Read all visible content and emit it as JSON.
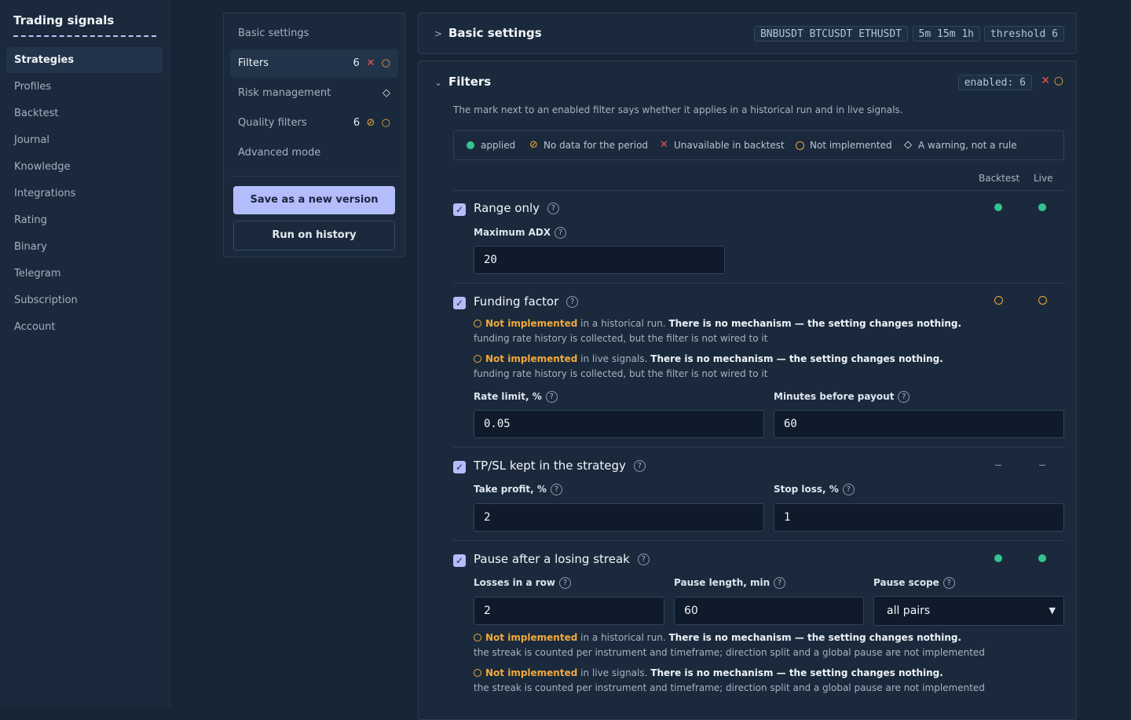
{
  "app": {
    "title": "Trading signals"
  },
  "nav": [
    "Strategies",
    "Profiles",
    "Backtest",
    "Journal",
    "Knowledge",
    "Integrations",
    "Rating",
    "Binary",
    "Telegram",
    "Subscription",
    "Account"
  ],
  "panel": {
    "items": [
      {
        "label": "Basic settings"
      },
      {
        "label": "Filters",
        "count": "6"
      },
      {
        "label": "Risk management"
      },
      {
        "label": "Quality filters",
        "count": "6"
      },
      {
        "label": "Advanced mode"
      }
    ],
    "save_label": "Save as a new version",
    "run_label": "Run on history"
  },
  "basic": {
    "title": "Basic settings",
    "pairs": "BNBUSDT BTCUSDT ETHUSDT",
    "timeframes": "5m 15m 1h",
    "threshold": "threshold 6"
  },
  "filters": {
    "title": "Filters",
    "enabled_chip": "enabled: 6",
    "description": "The mark next to an enabled filter says whether it applies in a historical run and in live signals.",
    "legend": {
      "applied": "applied",
      "no_data": "No data for the period",
      "unavailable": "Unavailable in backtest",
      "not_impl": "Not implemented",
      "warning": "A warning, not a rule"
    },
    "col_backtest": "Backtest",
    "col_live": "Live",
    "ni_label": "Not implemented",
    "hist_text": "in a historical run.",
    "live_text": "in live signals.",
    "no_mech": "There is no mechanism — the setting changes nothing.",
    "range_only": {
      "title": "Range only",
      "adx_label": "Maximum ADX",
      "adx_value": "20"
    },
    "funding": {
      "title": "Funding factor",
      "note": "funding rate history is collected, but the filter is not wired to it",
      "rate_label": "Rate limit, %",
      "rate_value": "0.05",
      "minutes_label": "Minutes before payout",
      "minutes_value": "60"
    },
    "tpsl": {
      "title": "TP/SL kept in the strategy",
      "tp_label": "Take profit, %",
      "tp_value": "2",
      "sl_label": "Stop loss, %",
      "sl_value": "1"
    },
    "pause": {
      "title": "Pause after a losing streak",
      "losses_label": "Losses in a row",
      "losses_value": "2",
      "length_label": "Pause length, min",
      "length_value": "60",
      "scope_label": "Pause scope",
      "scope_value": "all pairs",
      "note": "the streak is counted per instrument and timeframe; direction split and a global pause are not implemented"
    }
  },
  "colors": {
    "applied": "#34c38f",
    "not_implemented": "#f2a93b",
    "unavailable": "#ef5350",
    "accent": "#b4bdfc"
  }
}
